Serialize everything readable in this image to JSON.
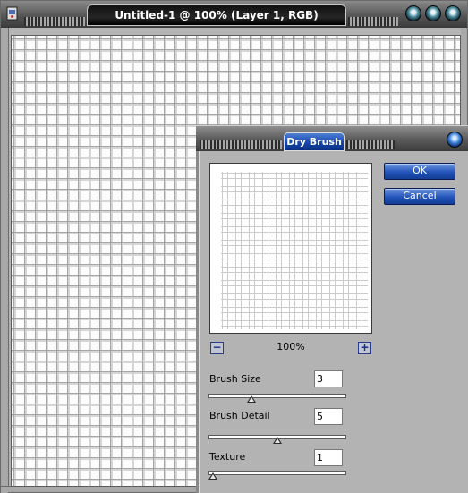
{
  "main_window": {
    "title": "Untitled-1 @ 100% (Layer 1, RGB)"
  },
  "dialog": {
    "title": "Dry Brush",
    "ok_label": "OK",
    "cancel_label": "Cancel",
    "zoom": "100%",
    "zoom_out_label": "−",
    "zoom_in_label": "+",
    "params": [
      {
        "label": "Brush Size",
        "value": "3",
        "level": 0.3
      },
      {
        "label": "Brush Detail",
        "value": "5",
        "level": 0.5
      },
      {
        "label": "Texture",
        "value": "1",
        "level": 0.0
      }
    ]
  },
  "colors": {
    "accent_button": "#2354bb",
    "title_tab_dialog": "#1547ad",
    "window_frame": "#b4b4b4"
  },
  "icons": [
    "app-document-icon",
    "minimize-icon",
    "maximize-icon",
    "close-icon",
    "dialog-close-icon",
    "zoom-out-icon",
    "zoom-in-icon"
  ]
}
